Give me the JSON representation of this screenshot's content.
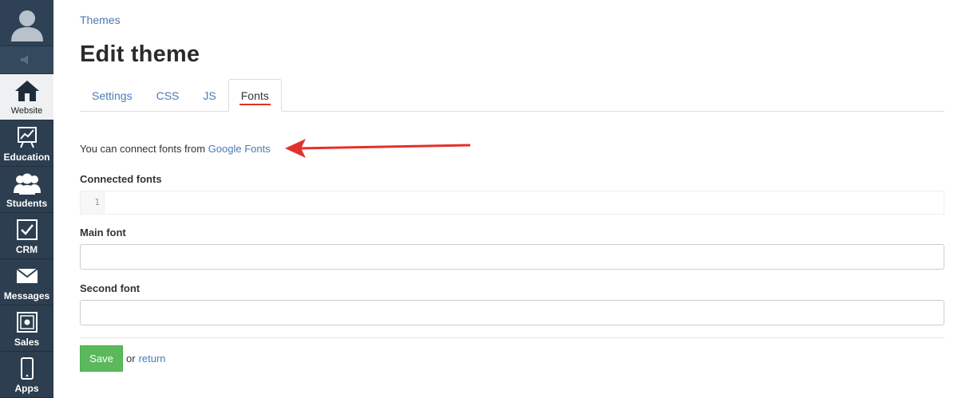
{
  "sidebar": {
    "items": [
      {
        "label": "Website",
        "icon": "home-icon",
        "active": true
      },
      {
        "label": "Education",
        "icon": "chart-board-icon",
        "active": false
      },
      {
        "label": "Students",
        "icon": "users-icon",
        "active": false
      },
      {
        "label": "CRM",
        "icon": "checkbox-icon",
        "active": false
      },
      {
        "label": "Messages",
        "icon": "envelope-icon",
        "active": false
      },
      {
        "label": "Sales",
        "icon": "safe-icon",
        "active": false
      },
      {
        "label": "Apps",
        "icon": "phone-icon",
        "active": false
      }
    ]
  },
  "breadcrumb": "Themes",
  "page_title": "Edit theme",
  "tabs": [
    {
      "label": "Settings",
      "active": false
    },
    {
      "label": "CSS",
      "active": false
    },
    {
      "label": "JS",
      "active": false
    },
    {
      "label": "Fonts",
      "active": true
    }
  ],
  "info": {
    "prefix": "You can connect fonts from",
    "link_text": "Google Fonts"
  },
  "fields": {
    "connected_fonts_label": "Connected fonts",
    "line_number": "1",
    "main_font_label": "Main font",
    "main_font_value": "",
    "second_font_label": "Second font",
    "second_font_value": ""
  },
  "actions": {
    "save_label": "Save",
    "or_text": "or",
    "return_label": "return"
  },
  "colors": {
    "sidebar_bg": "#2c3e50",
    "link": "#4a7ab6",
    "save_green": "#5cb85c",
    "annotation_red": "#e3302b"
  }
}
